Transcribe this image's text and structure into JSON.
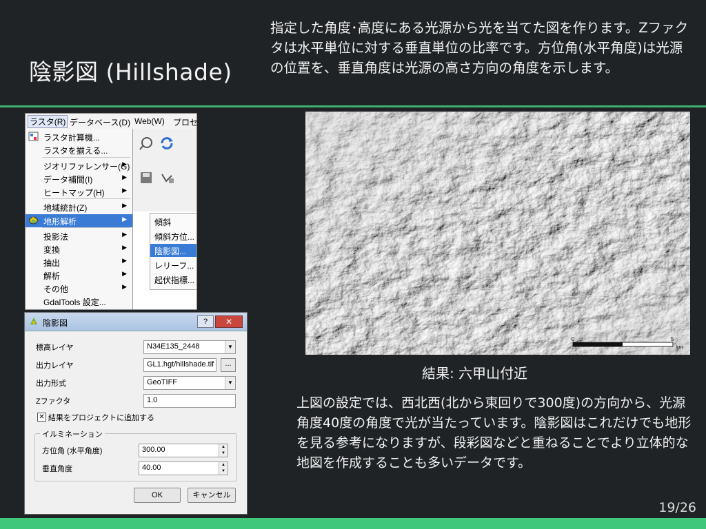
{
  "slide": {
    "title": "陰影図 (Hillshade)",
    "intro": "指定した角度･高度にある光源から光を当てた図を作ります。Zファクタは水平単位に対する垂直単位の比率です。方位角(水平角度)は光源の位置を、垂直角度は光源の高さ方向の角度を示します。",
    "caption": "結果: 六甲山付近",
    "body": "上図の設定では、西北西(北から東回りで300度)の方向から、光源角度40度の角度で光が当たっています。陰影図はこれだけでも地形を見る参考になりますが、段彩図などと重ねることでより立体的な地図を作成することも多いデータです。",
    "page_number": "19/26",
    "colors": {
      "background": "#1f2326",
      "accent": "#3db36e",
      "footer": "#3fc77b"
    }
  },
  "menu": {
    "menubar": [
      "ラスタ(R)",
      "データベース(D)",
      "Web(W)",
      "プロセ"
    ],
    "items": [
      {
        "label": "ラスタ計算機...",
        "icon": "calculator-icon",
        "arrow": false
      },
      {
        "label": "ラスタを揃える...",
        "icon": "",
        "arrow": false
      },
      {
        "label": "ジオリファレンサー(G)",
        "icon": "",
        "arrow": true
      },
      {
        "label": "データ補間(I)",
        "icon": "",
        "arrow": true
      },
      {
        "label": "ヒートマップ(H)",
        "icon": "",
        "arrow": true
      },
      {
        "label": "地域統計(Z)",
        "icon": "",
        "arrow": true
      },
      {
        "label": "地形解析",
        "icon": "terrain-icon",
        "arrow": true,
        "selected": true
      },
      {
        "label": "投影法",
        "icon": "",
        "arrow": true
      },
      {
        "label": "変換",
        "icon": "",
        "arrow": true
      },
      {
        "label": "抽出",
        "icon": "",
        "arrow": true
      },
      {
        "label": "解析",
        "icon": "",
        "arrow": true
      },
      {
        "label": "その他",
        "icon": "",
        "arrow": true
      },
      {
        "label": "GdalTools 設定...",
        "icon": "",
        "arrow": false
      }
    ],
    "submenu": [
      "傾斜",
      "傾斜方位...",
      "陰影図...",
      "レリーフ...",
      "起伏指標..."
    ],
    "arrow_glyph": "▶"
  },
  "dialog": {
    "title": "陰影図",
    "help": "?",
    "close": "✕",
    "elevation_layer_label": "標高レイヤ",
    "elevation_layer_value": "N34E135_2448",
    "output_layer_label": "出力レイヤ",
    "output_layer_value": "GL1.hgt/hillshade.tif",
    "browse": "...",
    "output_format_label": "出力形式",
    "output_format_value": "GeoTIFF",
    "zfactor_label": "Zファクタ",
    "zfactor_value": "1.0",
    "add_to_project_label": "結果をプロジェクトに追加する",
    "add_to_project_checked": "✕",
    "illumination_label": "イルミネーション",
    "azimuth_label": "方位角 (水平角度)",
    "azimuth_value": "300.00",
    "altitude_label": "垂直角度",
    "altitude_value": "40.00",
    "ok": "OK",
    "cancel": "キャンセル"
  },
  "hillshade": {
    "scale_labels": [
      "0",
      "5",
      "km"
    ]
  }
}
